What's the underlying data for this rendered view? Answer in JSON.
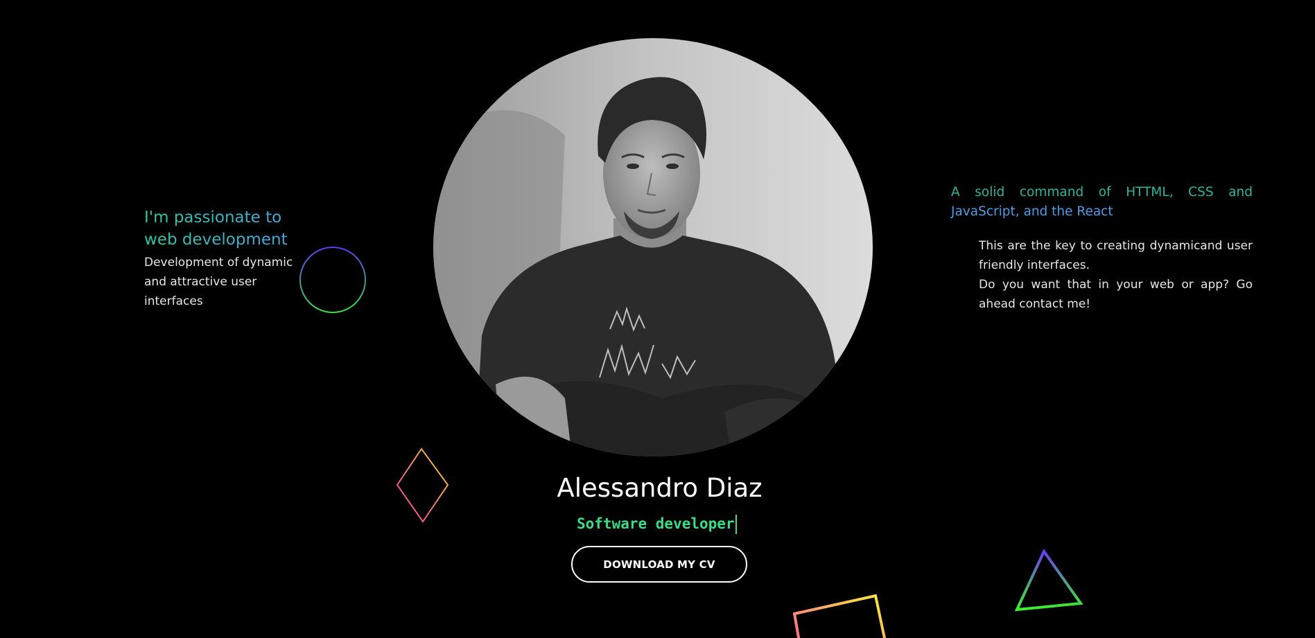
{
  "intro": {
    "title": "I'm passionate to web development",
    "text": "Development of dynamic and attractive user interfaces"
  },
  "skills": {
    "title_part1": "A solid command of HTTML, CSS and",
    "title_part2": "JavaScript, and the React",
    "paragraph1": "This are the key to creating dynamicand user friendly interfaces.",
    "paragraph2": "Do you want that in your web or app? Go ahead contact me!"
  },
  "profile": {
    "name": "Alessandro Diaz",
    "role": "Software developer",
    "cv_button_label": "DOWNLOAD MY CV"
  },
  "decorations": {
    "shapes": [
      "circle-outline",
      "diamond-outline",
      "triangle-outline",
      "square-outline"
    ]
  },
  "colors": {
    "background": "#000000",
    "accent_green": "#3ddc84",
    "accent_teal": "#31b49d",
    "accent_blue": "#4e9de6",
    "text": "#ffffff"
  }
}
